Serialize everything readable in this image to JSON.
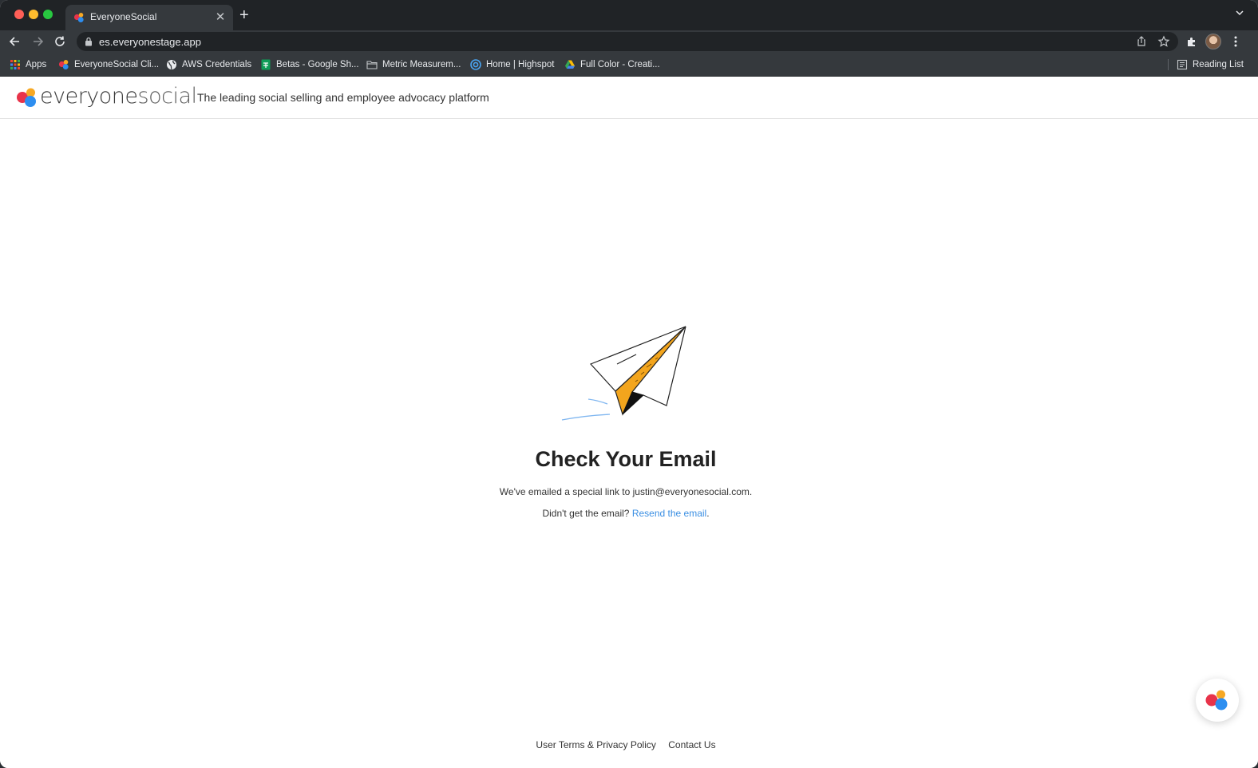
{
  "browser": {
    "tab": {
      "title": "EveryoneSocial",
      "close_glyph": "✕",
      "favicon": "everyonesocial-logo-icon"
    },
    "new_tab_glyph": "+",
    "url": "es.everyonestage.app",
    "bookmarks": [
      {
        "label": "Apps",
        "icon": "apps-grid-icon"
      },
      {
        "label": "EveryoneSocial Cli...",
        "icon": "everyonesocial-logo-icon"
      },
      {
        "label": "AWS Credentials",
        "icon": "globe-icon"
      },
      {
        "label": "Betas - Google Sh...",
        "icon": "google-sheets-icon"
      },
      {
        "label": "Metric Measurem...",
        "icon": "folder-icon"
      },
      {
        "label": "Home | Highspot",
        "icon": "highspot-icon"
      },
      {
        "label": "Full Color - Creati...",
        "icon": "google-drive-icon"
      }
    ],
    "reading_list": "Reading List"
  },
  "header": {
    "logo_main": "everyone",
    "logo_light": "social",
    "tagline": "The leading social selling and employee advocacy platform"
  },
  "main": {
    "heading": "Check Your Email",
    "message": "We've emailed a special link to justin@everyonesocial.com.",
    "resend_prefix": "Didn't get the email? ",
    "resend_link": "Resend the email",
    "resend_suffix": "."
  },
  "footer": {
    "terms": "User Terms & Privacy Policy",
    "contact": "Contact Us"
  },
  "colors": {
    "accent_link": "#3b8fe3",
    "plane_fold": "#f3a51d",
    "logo_red": "#e8334a",
    "logo_orange": "#f7a823",
    "logo_blue": "#2d8ef0"
  }
}
